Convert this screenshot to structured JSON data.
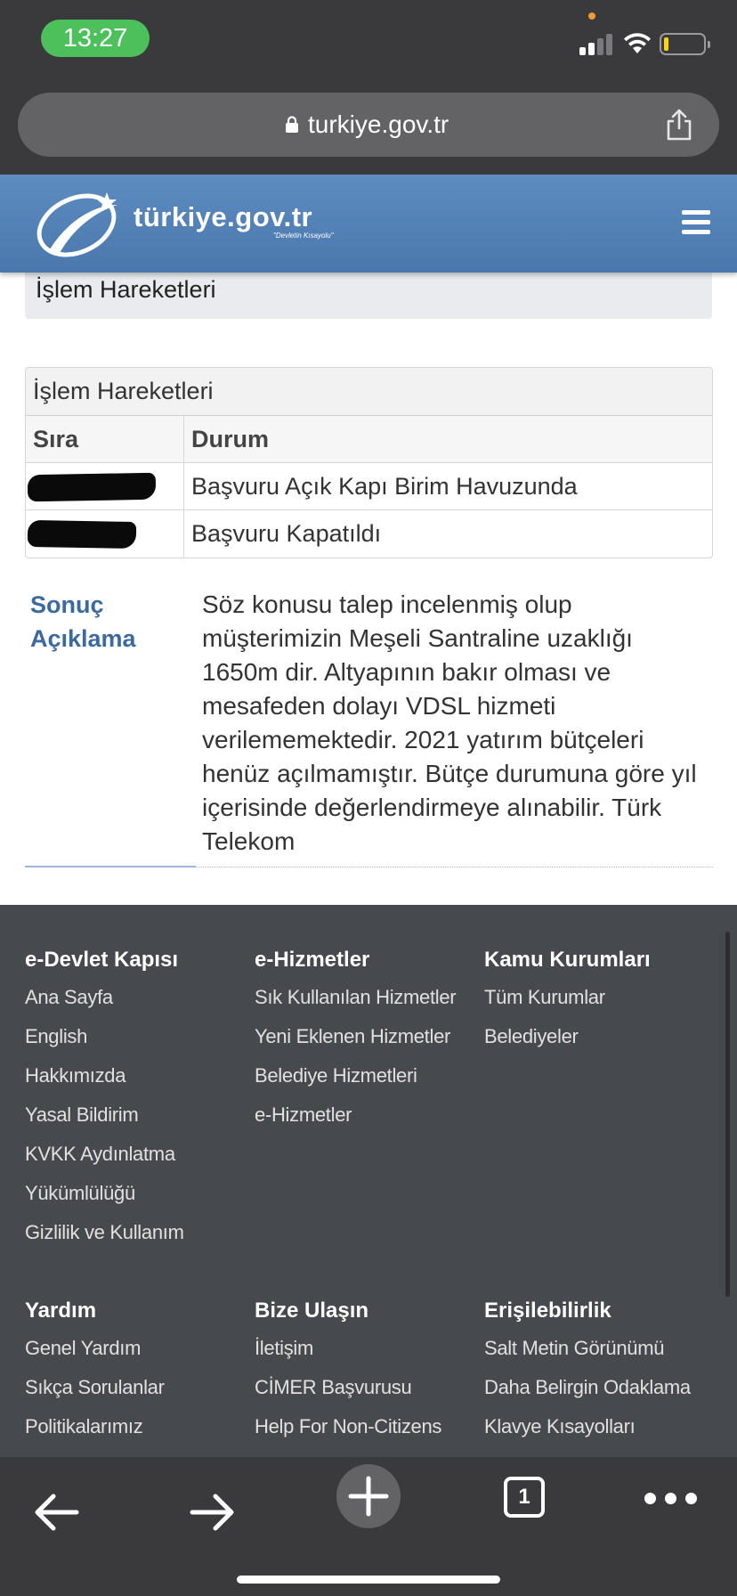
{
  "status_bar": {
    "time": "13:27"
  },
  "browser": {
    "url": "turkiye.gov.tr"
  },
  "site": {
    "logo_text": "türkiye.gov.tr",
    "logo_tagline": "\"Devletin Kısayolu\""
  },
  "page": {
    "heading": "İşlem Hareketleri"
  },
  "table": {
    "caption": "İşlem Hareketleri",
    "columns": [
      "Sıra",
      "Durum"
    ],
    "rows": [
      {
        "sira": "",
        "durum": "Başvuru Açık Kapı Birim Havuzunda"
      },
      {
        "sira": "",
        "durum": "Başvuru Kapatıldı"
      }
    ]
  },
  "result": {
    "label_line1": "Sonuç",
    "label_line2": "Açıklama",
    "text": "Söz konusu talep incelenmiş olup müşterimizin Meşeli Santraline uzaklığı 1650m dir. Altyapının bakır olması ve mesafeden dolayı VDSL hizmeti verilememektedir. 2021 yatırım bütçeleri henüz açılmamıştır. Bütçe durumuna göre yıl içerisinde değerlendirmeye alınabilir. Türk Telekom"
  },
  "footer": {
    "columns": [
      {
        "title": "e-Devlet Kapısı",
        "links": [
          "Ana Sayfa",
          "English",
          "Hakkımızda",
          "Yasal Bildirim",
          "KVKK Aydınlatma",
          "Yükümlülüğü",
          "Gizlilik ve Kullanım"
        ]
      },
      {
        "title": "e-Hizmetler",
        "links": [
          "Sık Kullanılan Hizmetler",
          "Yeni Eklenen Hizmetler",
          "Belediye Hizmetleri",
          "e-Hizmetler"
        ]
      },
      {
        "title": "Kamu Kurumları",
        "links": [
          "Tüm Kurumlar",
          "Belediyeler"
        ]
      },
      {
        "title": "Yardım",
        "links": [
          "Genel Yardım",
          "Sıkça Sorulanlar",
          "Politikalarımız"
        ]
      },
      {
        "title": "Bize Ulaşın",
        "links": [
          "İletişim",
          "CİMER Başvurusu",
          "Help For Non-Citizens"
        ]
      },
      {
        "title": "Erişilebilirlik",
        "links": [
          "Salt Metin Görünümü",
          "Daha Belirgin Odaklama",
          "Klavye Kısayolları"
        ]
      }
    ]
  },
  "toolbar": {
    "tab_count": "1"
  },
  "colors": {
    "header_blue": "#4a78ad",
    "status_green": "#4cc05a",
    "footer_bg": "#46494d",
    "label_blue": "#3d6a9e"
  }
}
